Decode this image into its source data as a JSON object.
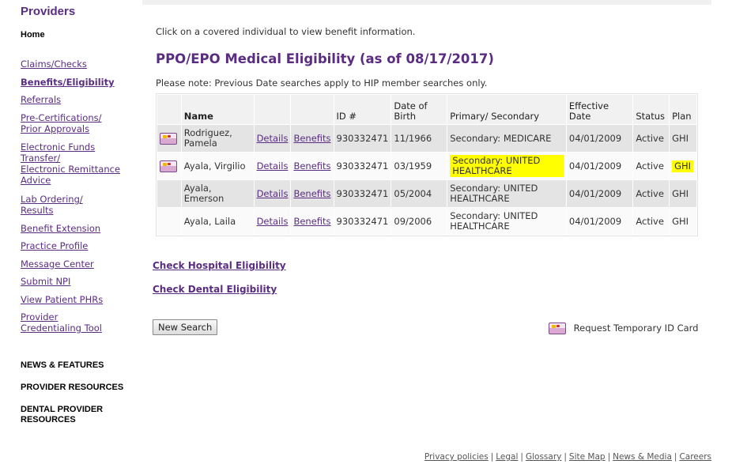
{
  "sidebar": {
    "title": "Providers",
    "home": "Home",
    "items": [
      {
        "label": "Claims/Checks"
      },
      {
        "label": "Benefits/Eligibility",
        "active": true
      },
      {
        "label": "Referrals"
      },
      {
        "label": "Pre-Certifications/\nPrior Approvals"
      },
      {
        "label": "Electronic Funds\nTransfer/\nElectronic Remittance\nAdvice"
      },
      {
        "label": "Lab Ordering/\nResults"
      },
      {
        "label": "Benefit Extension"
      },
      {
        "label": "Practice Profile"
      },
      {
        "label": "Message Center"
      },
      {
        "label": "Submit NPI"
      },
      {
        "label": "View Patient PHRs"
      },
      {
        "label": "Provider\nCredentialing Tool"
      }
    ],
    "sections": [
      "NEWS & FEATURES",
      "PROVIDER RESOURCES",
      "DENTAL PROVIDER\nRESOURCES"
    ]
  },
  "main": {
    "instruction": "Click on a covered individual to view benefit information.",
    "heading": "PPO/EPO Medical Eligibility (as of 08/17/2017)",
    "note": "Please note: Previous Date searches apply to HIP member searches only.",
    "table": {
      "headers": {
        "name": "Name",
        "id": "ID #",
        "dob": "Date of Birth",
        "primary": "Primary/ Secondary",
        "effective": "Effective Date",
        "status": "Status",
        "plan": "Plan"
      },
      "rows": [
        {
          "icon": true,
          "name": "Rodriguez, Pamela",
          "details": "Details",
          "benefits": "Benefits",
          "id": "930332471",
          "dob": "11/1966",
          "primary": "Secondary: MEDICARE",
          "effective": "04/01/2009",
          "status": "Active",
          "plan": "GHI",
          "highlight": false
        },
        {
          "icon": true,
          "name": "Ayala, Virgilio",
          "details": "Details",
          "benefits": "Benefits",
          "id": "930332471",
          "dob": "03/1959",
          "primary": "Secondary: UNITED HEALTHCARE",
          "effective": "04/01/2009",
          "status": "Active",
          "plan": "GHI",
          "highlight": true
        },
        {
          "icon": false,
          "name": "Ayala, Emerson",
          "details": "Details",
          "benefits": "Benefits",
          "id": "930332471",
          "dob": "05/2004",
          "primary": "Secondary: UNITED HEALTHCARE",
          "effective": "04/01/2009",
          "status": "Active",
          "plan": "GHI",
          "highlight": false
        },
        {
          "icon": false,
          "name": "Ayala, Laila",
          "details": "Details",
          "benefits": "Benefits",
          "id": "930332471",
          "dob": "09/2006",
          "primary": "Secondary: UNITED HEALTHCARE",
          "effective": "04/01/2009",
          "status": "Active",
          "plan": "GHI",
          "highlight": false
        }
      ]
    },
    "check_hospital": "Check Hospital Eligibility",
    "check_dental": "Check Dental Eligibility",
    "new_search": "New Search",
    "temp_id": "Request Temporary ID Card"
  },
  "footer": [
    "Privacy policies",
    "Legal",
    "Glossary",
    "Site Map",
    "News & Media",
    "Careers"
  ],
  "colors": {
    "brand": "#5a2d82",
    "highlight": "#ffff00"
  },
  "icons": {
    "member_card": "id-card-icon"
  }
}
